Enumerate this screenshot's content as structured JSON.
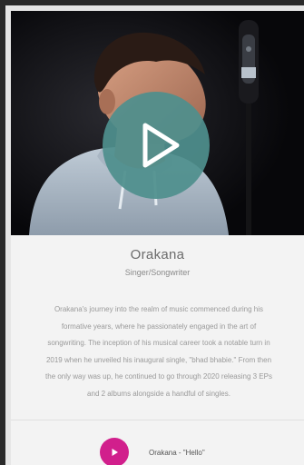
{
  "artist": {
    "name": "Orakana",
    "role": "Singer/Songwriter",
    "bio_lines": [
      "Orakana's journey into the realm of music commenced during his",
      "formative years, where he passionately engaged in the art of",
      "songwriting. The inception of his musical career took a notable turn in",
      "2019 when he unveiled his inaugural single, \"bhad bhabie.\" From then",
      "the only way was up, he continued to go through 2020 releasing 3 EPs",
      "and 2 albums alongside a handful of singles."
    ]
  },
  "player": {
    "main_play_icon": "play-icon",
    "track_title": "Orakana - \"Hello\"",
    "track_play_icon": "play-icon"
  },
  "colors": {
    "play_overlay": "#4f8f8d",
    "track_button": "#d11f8c"
  }
}
